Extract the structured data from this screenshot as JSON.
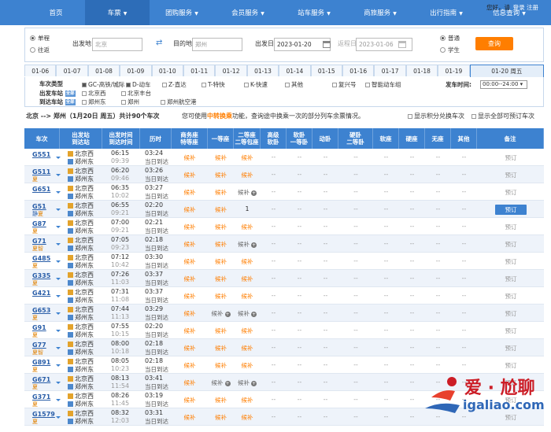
{
  "nav": {
    "items": [
      "首页",
      "车票",
      "团购服务",
      "会员服务",
      "站车服务",
      "商旅服务",
      "出行指南",
      "信息查询"
    ],
    "greeting": "您好，请",
    "login": "登录 注册"
  },
  "search": {
    "trip_oneway": "单程",
    "trip_round": "往返",
    "from_label": "出发地",
    "from_value": "北京",
    "to_label": "目的地",
    "to_value": "郑州",
    "depart_label": "出发日",
    "depart_value": "2023-01-20",
    "return_label": "返程日",
    "return_value": "2023-01-06",
    "type_normal": "普通",
    "type_student": "学生",
    "query": "查询"
  },
  "dates": [
    "01-06",
    "01-07",
    "01-08",
    "01-09",
    "01-10",
    "01-11",
    "01-12",
    "01-13",
    "01-14",
    "01-15",
    "01-16",
    "01-17",
    "01-18",
    "01-19",
    "01-20 周五"
  ],
  "filters": {
    "type_label": "车次类型",
    "types": [
      "GC-高铁/城际",
      "D-动车",
      "Z-直达",
      "T-特快",
      "K-快速",
      "其他",
      "复兴号",
      "智能动车组"
    ],
    "depart_time_label": "发车时间:",
    "depart_time_value": "00:00--24:00",
    "from_station_label": "出发车站",
    "all_label": "全部",
    "from_stations": [
      "北京西",
      "北京丰台"
    ],
    "to_station_label": "到达车站",
    "to_stations": [
      "郑州东",
      "郑州",
      "郑州航空港"
    ]
  },
  "summary": {
    "route": "北京 --> 郑州（1月20日 周五）共计90个车次",
    "tip_pre": "您可使用",
    "tip_key": "中转换乘",
    "tip_post": "功能，查询途中换乘一次的部分列车余票情况。",
    "opt1": "显示积分兑换车次",
    "opt2": "显示全部可预订车次"
  },
  "headers": [
    "车次",
    "出发站\n到达站",
    "出发时间\n到达时间",
    "历时",
    "商务座\n特等座",
    "一等座",
    "二等座\n二等包座",
    "高级\n软卧",
    "软卧\n一等卧",
    "动卧",
    "硬卧\n二等卧",
    "软座",
    "硬座",
    "无座",
    "其他",
    "备注"
  ],
  "rows": [
    {
      "no": "G551",
      "tags": [
        "",
        ""
      ],
      "from": "北京西",
      "to": "郑州东",
      "dep": "06:15",
      "arr": "09:39",
      "dur": "03:24",
      "day": "当日到达",
      "biz": "候补",
      "first": "候补",
      "second": "候补",
      "second_plus": false,
      "first_plus": false,
      "book": "预订",
      "active": false
    },
    {
      "no": "G511",
      "tags": [
        "",
        "夏"
      ],
      "from": "北京西",
      "to": "郑州东",
      "dep": "06:20",
      "arr": "09:46",
      "dur": "03:26",
      "day": "当日到达",
      "biz": "候补",
      "first": "候补",
      "second": "候补",
      "second_plus": false,
      "first_plus": false,
      "book": "预订",
      "active": false
    },
    {
      "no": "G651",
      "tags": [
        "",
        ""
      ],
      "from": "北京西",
      "to": "郑州东",
      "dep": "06:35",
      "arr": "10:02",
      "dur": "03:27",
      "day": "当日到达",
      "biz": "候补",
      "first": "候补",
      "second": "候补",
      "second_plus": true,
      "first_plus": false,
      "book": "预订",
      "active": false
    },
    {
      "no": "G51",
      "tags": [
        "静",
        "夏"
      ],
      "from": "北京西",
      "to": "郑州东",
      "dep": "06:55",
      "arr": "09:21",
      "dur": "02:20",
      "day": "当日到达",
      "biz": "候补",
      "first": "候补",
      "second": "1",
      "second_plus": false,
      "first_plus": false,
      "book": "预订",
      "active": true
    },
    {
      "no": "G87",
      "tags": [
        "",
        "夏"
      ],
      "from": "北京西",
      "to": "郑州东",
      "dep": "07:00",
      "arr": "09:21",
      "dur": "02:21",
      "day": "当日到达",
      "biz": "候补",
      "first": "候补",
      "second": "候补",
      "second_plus": false,
      "first_plus": false,
      "book": "预订",
      "active": false
    },
    {
      "no": "G71",
      "tags": [
        "",
        "夏智"
      ],
      "from": "北京西",
      "to": "郑州东",
      "dep": "07:05",
      "arr": "09:23",
      "dur": "02:18",
      "day": "当日到达",
      "biz": "候补",
      "first": "候补",
      "second": "候补",
      "second_plus": true,
      "first_plus": false,
      "book": "预订",
      "active": false
    },
    {
      "no": "G485",
      "tags": [
        "",
        "夏"
      ],
      "from": "北京西",
      "to": "郑州东",
      "dep": "07:12",
      "arr": "10:42",
      "dur": "03:30",
      "day": "当日到达",
      "biz": "候补",
      "first": "候补",
      "second": "候补",
      "second_plus": false,
      "first_plus": false,
      "book": "预订",
      "active": false
    },
    {
      "no": "G335",
      "tags": [
        "",
        "夏"
      ],
      "from": "北京西",
      "to": "郑州东",
      "dep": "07:26",
      "arr": "11:03",
      "dur": "03:37",
      "day": "当日到达",
      "biz": "候补",
      "first": "候补",
      "second": "候补",
      "second_plus": false,
      "first_plus": false,
      "book": "预订",
      "active": false
    },
    {
      "no": "G421",
      "tags": [
        "",
        ""
      ],
      "from": "北京西",
      "to": "郑州东",
      "dep": "07:31",
      "arr": "11:08",
      "dur": "03:37",
      "day": "当日到达",
      "biz": "候补",
      "first": "候补",
      "second": "候补",
      "second_plus": false,
      "first_plus": false,
      "book": "预订",
      "active": false
    },
    {
      "no": "G653",
      "tags": [
        "",
        "夏"
      ],
      "from": "北京西",
      "to": "郑州东",
      "dep": "07:44",
      "arr": "11:13",
      "dur": "03:29",
      "day": "当日到达",
      "biz": "候补",
      "first": "候补",
      "second": "候补",
      "second_plus": true,
      "first_plus": true,
      "book": "预订",
      "active": false
    },
    {
      "no": "G91",
      "tags": [
        "",
        "夏"
      ],
      "from": "北京西",
      "to": "郑州东",
      "dep": "07:55",
      "arr": "10:15",
      "dur": "02:20",
      "day": "当日到达",
      "biz": "候补",
      "first": "候补",
      "second": "候补",
      "second_plus": false,
      "first_plus": false,
      "book": "预订",
      "active": false
    },
    {
      "no": "G77",
      "tags": [
        "",
        "夏智"
      ],
      "from": "北京西",
      "to": "郑州东",
      "dep": "08:00",
      "arr": "10:18",
      "dur": "02:18",
      "day": "当日到达",
      "biz": "候补",
      "first": "候补",
      "second": "候补",
      "second_plus": false,
      "first_plus": false,
      "book": "预订",
      "active": false
    },
    {
      "no": "G891",
      "tags": [
        "",
        "夏"
      ],
      "from": "北京西",
      "to": "郑州东",
      "dep": "08:05",
      "arr": "10:23",
      "dur": "02:18",
      "day": "当日到达",
      "biz": "候补",
      "first": "候补",
      "second": "候补",
      "second_plus": false,
      "first_plus": false,
      "book": "预订",
      "active": false
    },
    {
      "no": "G671",
      "tags": [
        "",
        "夏"
      ],
      "from": "北京西",
      "to": "郑州东",
      "dep": "08:13",
      "arr": "11:54",
      "dur": "03:41",
      "day": "当日到达",
      "biz": "候补",
      "first": "候补",
      "second": "候补",
      "second_plus": true,
      "first_plus": true,
      "book": "预订",
      "active": false
    },
    {
      "no": "G371",
      "tags": [
        "",
        "夏"
      ],
      "from": "北京西",
      "to": "郑州东",
      "dep": "08:26",
      "arr": "11:45",
      "dur": "03:19",
      "day": "当日到达",
      "biz": "候补",
      "first": "候补",
      "second": "候补",
      "second_plus": false,
      "first_plus": false,
      "book": "预订",
      "active": false
    },
    {
      "no": "G1579",
      "tags": [
        "",
        "夏"
      ],
      "from": "北京西",
      "to": "郑州东",
      "dep": "08:32",
      "arr": "12:03",
      "dur": "03:31",
      "day": "当日到达",
      "biz": "候补",
      "first": "候补",
      "second": "候补",
      "second_plus": false,
      "first_plus": false,
      "book": "预订",
      "active": false
    }
  ],
  "empty_cell": "--",
  "watermark": {
    "cn": "爱 · 尬聊",
    "en": "igaliao.com"
  },
  "colors": {
    "primary": "#3d82d0",
    "orange": "#ff7e00"
  }
}
